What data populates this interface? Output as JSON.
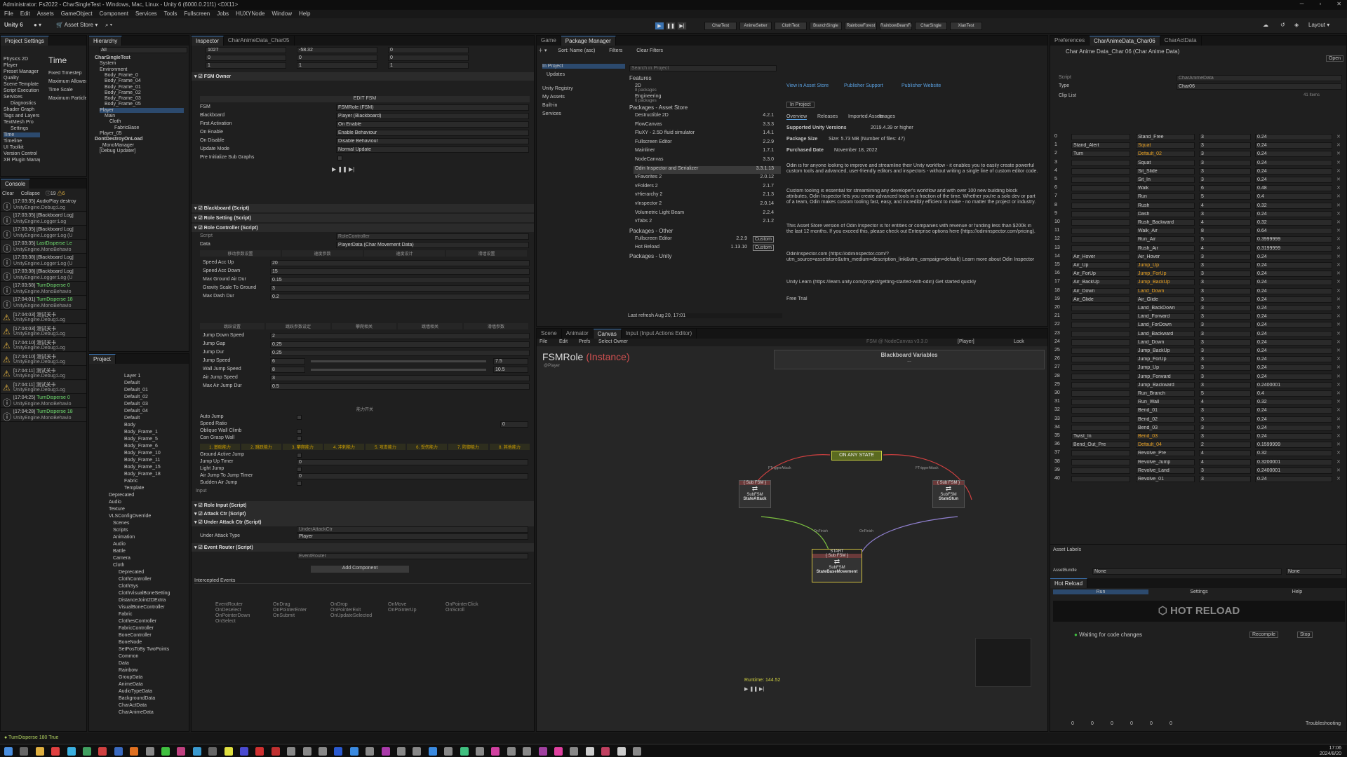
{
  "window": {
    "title": "Administrator: Fs2022 - CharSingleTest - Windows, Mac, Linux - Unity 6 (6000.0.21f1) <DX11>"
  },
  "menu": [
    "File",
    "Edit",
    "Assets",
    "GameObject",
    "Component",
    "Services",
    "Tools",
    "Fullscreen",
    "Jobs",
    "HUXYNode",
    "Window",
    "Help"
  ],
  "toolbar": {
    "account": "Unity 6",
    "asset_store": "Asset Store",
    "layouts": [
      "CharTest",
      "AnimeSetter",
      "ClothTest",
      "BranchSingle",
      "RainbowForest",
      "RainbowBeamFog",
      "CharSingle",
      "XianTest"
    ],
    "layout": "Layout"
  },
  "project_settings": {
    "tab": "Project Settings",
    "heading": "Time",
    "items": [
      "Physics 2D",
      "Player",
      "Preset Manager",
      "Quality",
      "Scene Template",
      "Script Execution",
      "Services",
      "Diagnostics",
      "Shader Graph",
      "Tags and Layers",
      "TextMesh Pro",
      "Settings",
      "Time",
      "Timeline",
      "UI Toolkit",
      "Version Control",
      "XR Plugin Management"
    ],
    "fields": [
      "Fixed Timestep",
      "Maximum Allowed",
      "Time Scale",
      "Maximum Particle"
    ]
  },
  "console": {
    "tab": "Console",
    "clear": "Clear",
    "collapse": "Collapse",
    "count_info": "19",
    "count_warn": "6",
    "entries": [
      {
        "type": "info",
        "time": "[17:03:35]",
        "msg": "AudioPlay destroy",
        "sub": "UnityEngine.Debug:Log"
      },
      {
        "type": "info",
        "time": "[17:03:35]",
        "msg": "[Blackboard Log]",
        "sub": "UnityEngine.Logger:Log"
      },
      {
        "type": "info",
        "time": "[17:03:35]",
        "msg": "[Blackboard Log]",
        "sub": "UnityEngine.Logger:Log (U"
      },
      {
        "type": "info",
        "time": "[17:03:35]",
        "msg": "LastDisperse Le",
        "sub": "UnityEngine.MonoBehavio"
      },
      {
        "type": "info",
        "time": "[17:03:38]",
        "msg": "[Blackboard Log]",
        "sub": "UnityEngine.Logger:Log (U"
      },
      {
        "type": "info",
        "time": "[17:03:38]",
        "msg": "[Blackboard Log]",
        "sub": "UnityEngine.Logger:Log (U"
      },
      {
        "type": "info",
        "time": "[17:03:58]",
        "msg": "TurnDisperse 0",
        "sub": "UnityEngine.MonoBehavio"
      },
      {
        "type": "info",
        "time": "[17:04:01]",
        "msg": "TurnDisperse 18",
        "sub": "UnityEngine.MonoBehavio"
      },
      {
        "type": "warn",
        "time": "[17:04:03]",
        "msg": "测试关卡",
        "sub": "UnityEngine.Debug:Log"
      },
      {
        "type": "warn",
        "time": "[17:04:03]",
        "msg": "测试关卡",
        "sub": "UnityEngine.Debug:Log"
      },
      {
        "type": "warn",
        "time": "[17:04:10]",
        "msg": "测试关卡",
        "sub": "UnityEngine.Debug:Log"
      },
      {
        "type": "warn",
        "time": "[17:04:10]",
        "msg": "测试关卡",
        "sub": "UnityEngine.Debug:Log"
      },
      {
        "type": "warn",
        "time": "[17:04:11]",
        "msg": "测试关卡",
        "sub": "UnityEngine.Debug:Log"
      },
      {
        "type": "warn",
        "time": "[17:04:11]",
        "msg": "测试关卡",
        "sub": "UnityEngine.Debug:Log"
      },
      {
        "type": "info",
        "time": "[17:04:25]",
        "msg": "TurnDisperse 0",
        "sub": "UnityEngine.MonoBehavio"
      },
      {
        "type": "info",
        "time": "[17:04:28]",
        "msg": "TurnDisperse 18",
        "sub": "UnityEngine.MonoBehavio"
      }
    ]
  },
  "hierarchy": {
    "tab": "Hierarchy",
    "search": "All",
    "items": [
      "CharSingleTest",
      "System",
      "Environment",
      "Body_Frame_0",
      "Body_Frame_04",
      "Body_Frame_01",
      "Body_Frame_02",
      "Body_Frame_03",
      "Body_Frame_05",
      "Player",
      "Main",
      "Cloth",
      "FabricBase",
      "Player_05",
      "DontDestroyOnLoad",
      "_MonoManager",
      "[Debug Updater]"
    ]
  },
  "project": {
    "tab": "Project",
    "items": [
      "Layer 1",
      "Default",
      "Default_01",
      "Default_02",
      "Default_03",
      "Default_04",
      "Default",
      "Body",
      "Body_Frame_1",
      "Body_Frame_5",
      "Body_Frame_6",
      "Body_Frame_10",
      "Body_Frame_11",
      "Body_Frame_15",
      "Body_Frame_18",
      "Fabric",
      "Template",
      "Deprecated",
      "Audio",
      "Texture",
      "VLSConfigOverride",
      "Scenes",
      "Scripts",
      "Animation",
      "Audio",
      "Battle",
      "Camera",
      "Cloth",
      "Deprecated",
      "ClothController",
      "ClothSys",
      "ClothVisualBoneSetting",
      "DistanceJoint2DExtra",
      "VisualBoneController",
      "Fabric",
      "ClothesController",
      "FabricController",
      "BoneController",
      "BoneNode",
      "SetPosToBy TwoPoints",
      "Common",
      "Data",
      "Rainbow",
      "GroupData",
      "AnimeData",
      "AudioTypeData",
      "BackgroundData",
      "CharActData",
      "CharAnimeData"
    ]
  },
  "inspector": {
    "tab": "Inspector",
    "tab2": "CharAnimeData_Char05",
    "transform": [
      {
        "x": "1027",
        "y": "-58.32",
        "z": "0"
      },
      {
        "x": "0",
        "y": "0",
        "z": "0"
      },
      {
        "x": "1",
        "y": "1",
        "z": "1"
      }
    ],
    "fsm_owner": {
      "title": "FSM Owner",
      "edit": "EDIT FSM",
      "fields": [
        [
          "FSM",
          "FSMRole (FSM)"
        ],
        [
          "Blackboard",
          "Player (Blackboard)"
        ],
        [
          "First Activation",
          "On Enable"
        ],
        [
          "On Enable",
          "Enable Behaviour"
        ],
        [
          "On Disable",
          "Disable Behaviour"
        ],
        [
          "Update Mode",
          "Normal Update"
        ],
        [
          "Pre Initialize Sub Graphs",
          ""
        ]
      ]
    },
    "components": [
      "Blackboard (Script)",
      "Role Setting (Script)",
      "Role Controller (Script)"
    ],
    "script_label": "Script",
    "script_value": "RoleController",
    "data_label": "Data",
    "data_value": "PlayerData (Char Movement Data)",
    "subtabs1": [
      "移动参数设置",
      "速度参数",
      "速度设计",
      "滑墙设置"
    ],
    "move_fields": [
      [
        "Speed Acc Up",
        "20"
      ],
      [
        "Speed Acc Down",
        "15"
      ],
      [
        "Max Ground Air Dur",
        "0.15"
      ],
      [
        "Gravity Scale To Ground",
        "3"
      ],
      [
        "Max Dash Dur",
        "0.2"
      ]
    ],
    "subtabs2": [
      "跳跃设置",
      "跳跃参数设定",
      "攀爬相关",
      "跳墙相关",
      "滑墙参数"
    ],
    "jump_fields": [
      [
        "Jump Down Speed",
        "2"
      ],
      [
        "Jump Gap",
        "0.25"
      ],
      [
        "Jump Dur",
        "0.25"
      ],
      [
        "Jump Speed",
        "6",
        "7.5"
      ],
      [
        "Wall Jump Speed",
        "8",
        "10.5"
      ],
      [
        "Air Jump Speed",
        "3"
      ],
      [
        "Max Air Jump Dur",
        "0.5"
      ]
    ],
    "ability_title": "能力开关",
    "ability_fields": [
      [
        "Auto Jump",
        ""
      ],
      [
        "Speed Ratio",
        "0"
      ],
      [
        "Oblique Wall Climb",
        ""
      ],
      [
        "Can Grasp Wall",
        ""
      ]
    ],
    "colortabs": [
      "1. 基础能力",
      "2. 跳跃能力",
      "3. 攀爬能力",
      "4. 冲刺能力",
      "5. 攻击能力",
      "6. 受伤能力",
      "7. 防御能力",
      "8. 其他能力"
    ],
    "state_fields": [
      [
        "Ground Active Jump",
        ""
      ],
      [
        "Jump Up Timer",
        "0"
      ],
      [
        "Light Jump",
        ""
      ],
      [
        "Air Jump To Jump Timer",
        "0"
      ],
      [
        "Sudden Air Jump",
        ""
      ]
    ],
    "input_label": "Input",
    "components2": [
      "Role Input (Script)",
      "Attack Ctr (Script)",
      "Under Attack Ctr (Script)"
    ],
    "under_script": "UnderAttackCtr",
    "under_type_label": "Under Attack Type",
    "under_type": "Player",
    "event_router": "Event Router (Script)",
    "event_script": "EventRouter",
    "add_component": "Add Component",
    "intercepted": "Intercepted Events",
    "events": [
      [
        "EventRouter",
        "OnDeselect",
        "OnPointerDown",
        "OnSelect"
      ],
      [
        "OnDrag",
        "OnPointerEnter",
        "OnSubmit"
      ],
      [
        "OnDrop",
        "OnPointerExit",
        "OnUpdateSelected"
      ],
      [
        "OnMove",
        "OnPointerUp"
      ],
      [
        "OnPointerClick",
        "OnScroll"
      ]
    ]
  },
  "package_manager": {
    "tabs": [
      "Game",
      "Package Manager"
    ],
    "sort": "Sort: Name (asc)",
    "filters": "Filters",
    "clear_filters": "Clear Filters",
    "search": "Search in Project",
    "left": [
      "In Project",
      "Updates",
      "Unity Registry",
      "My Assets",
      "Built-in",
      "Services"
    ],
    "features_title": "Features",
    "features": [
      [
        "2D",
        "8 packages"
      ],
      [
        "Engineering",
        "6 packages"
      ]
    ],
    "asset_title": "Packages - Asset Store",
    "assets": [
      [
        "Destructible 2D",
        "4.2.1"
      ],
      [
        "FlowCanvas",
        "3.3.3"
      ],
      [
        "FluXY - 2.5D fluid simulator",
        "1.4.1"
      ],
      [
        "Fullscreen Editor",
        "2.2.9"
      ],
      [
        "Mainliner",
        "1.7.1"
      ],
      [
        "NodeCanvas",
        "3.3.0"
      ],
      [
        "Odin Inspector and Serializer",
        "3.3.1.13"
      ],
      [
        "vFavorites 2",
        "2.0.12"
      ],
      [
        "vFolders 2",
        "2.1.7"
      ],
      [
        "vHierarchy 2",
        "2.1.3"
      ],
      [
        "vInspector 2",
        "2.0.14"
      ],
      [
        "Volumetric Light Beam",
        "2.2.4"
      ],
      [
        "vTabs 2",
        "2.1.2"
      ]
    ],
    "other_title": "Packages - Other",
    "others": [
      [
        "Fullscreen Editor",
        "2.2.9",
        "Custom"
      ],
      [
        "Hot Reload",
        "1.13.10",
        "Custom"
      ]
    ],
    "unity_title": "Packages - Unity",
    "refresh": "Last refresh Aug 20, 17:01",
    "detail": {
      "links": [
        "View in Asset Store",
        "Publisher Support",
        "Publisher Website"
      ],
      "in_project": "In Project",
      "subtabs": [
        "Overview",
        "Releases",
        "Imported Assets",
        "Images"
      ],
      "versions_label": "Supported Unity Versions",
      "versions": "2019.4.39 or higher",
      "size_label": "Package Size",
      "size": "Size: 5.73 MB (Number of files: 47)",
      "purchased_label": "Purchased Date",
      "purchased": "November 18, 2022",
      "desc1": "Odin is for anyone looking to improve and streamline their Unity workflow - it enables you to easily create powerful custom tools and advanced, user-friendly editors and inspectors - without writing a single line of custom editor code.",
      "desc2": "Custom tooling is essential for streamlining any developer's workflow and with over 100 new building block attributes, Odin Inspector lets you create advanced tools in a fraction of the time. Whether you're a solo dev or part of a team, Odin makes custom tooling fast, easy, and incredibly efficient to make - no matter the project or industry.",
      "desc3": "This Asset Store version of Odin Inspector is for entities or companies with revenue or funding less than $200k in the last 12 months. If you exceed this, please check out Enterprise options here (https://odininspector.com/pricing).",
      "desc4": "OdinInspector.com (https://odininspector.com/?utm_source=assetstore&utm_medium=description_link&utm_campaign=default) Learn more about Odin Inspector",
      "desc5": "Unity Learn (https://learn.unity.com/project/getting-started-with-odin) Get started quickly",
      "free": "Free Trial"
    }
  },
  "graph": {
    "tabs": [
      "Scene",
      "Animator",
      "Canvas",
      "Input (Input Actions Editor)"
    ],
    "menu": [
      "File",
      "Edit",
      "Prefs",
      "Select Owner"
    ],
    "owner": "[Player]",
    "lock": "Lock",
    "fsm_label": "FSM @ NodeCanvas v3.3.0",
    "title": "FSMRole",
    "instance": "(Instance)",
    "sub": "@Player",
    "blackboard": "Blackboard Variables",
    "bb_dots": "...",
    "any_state": "ON ANY STATE",
    "start": "START",
    "nodes": [
      {
        "tag": "{ Sub FSM }",
        "name": "SubFSM",
        "state": "StateAttack"
      },
      {
        "tag": "{ Sub FSM }",
        "name": "SubFSM",
        "state": "StateStun"
      },
      {
        "tag": "{ Sub FSM }",
        "name": "SubFSM",
        "state": "StateBaseMovement"
      }
    ],
    "edges": [
      "FTriggerAttack",
      "FTriggerAttack",
      "OnFinish",
      "OnFinish"
    ],
    "runtime": "Runtime: 144.52"
  },
  "right": {
    "tabs": [
      "Preferences",
      "CharAnimeData_Char06",
      "CharActData"
    ],
    "obj": "Char Anime Data_Char 06 (Char Anime Data)",
    "open": "Open",
    "script_label": "Script",
    "script": "CharAnimeData",
    "type_label": "Type",
    "type": "Char06",
    "clip_list": "Clip List",
    "items_label": "41 Items",
    "cols": [
      "Name",
      "Clip",
      "Total Frames",
      "Duration"
    ],
    "rows": [
      [
        "0",
        "",
        "Stand_Free",
        "3",
        "0.24"
      ],
      [
        "1",
        "Stand_Alert",
        "Squat",
        "3",
        "0.24"
      ],
      [
        "2",
        "Turn",
        "Default_02",
        "3",
        "0.24"
      ],
      [
        "3",
        "",
        "Squat",
        "3",
        "0.24"
      ],
      [
        "4",
        "",
        "Sit_Slide",
        "3",
        "0.24"
      ],
      [
        "5",
        "",
        "Sit_In",
        "3",
        "0.24"
      ],
      [
        "6",
        "",
        "Walk",
        "6",
        "0.48"
      ],
      [
        "7",
        "",
        "Run",
        "5",
        "0.4"
      ],
      [
        "8",
        "",
        "Rush",
        "4",
        "0.32"
      ],
      [
        "9",
        "",
        "Dash",
        "3",
        "0.24"
      ],
      [
        "10",
        "",
        "Rush_Backward",
        "4",
        "0.32"
      ],
      [
        "11",
        "",
        "Walk_Air",
        "8",
        "0.64"
      ],
      [
        "12",
        "",
        "Run_Air",
        "5",
        "0.3999999"
      ],
      [
        "13",
        "",
        "Rush_Air",
        "4",
        "0.3199999"
      ],
      [
        "14",
        "Air_Hover",
        "Air_Hover",
        "3",
        "0.24"
      ],
      [
        "15",
        "Air_Up",
        "Jump_Up",
        "3",
        "0.24"
      ],
      [
        "16",
        "Air_ForUp",
        "Jump_ForUp",
        "3",
        "0.24"
      ],
      [
        "17",
        "Air_BackUp",
        "Jump_BackUp",
        "3",
        "0.24"
      ],
      [
        "18",
        "Air_Down",
        "Land_Down",
        "3",
        "0.24"
      ],
      [
        "19",
        "Air_Glide",
        "Air_Glide",
        "3",
        "0.24"
      ],
      [
        "20",
        "",
        "Land_BackDown",
        "3",
        "0.24"
      ],
      [
        "21",
        "",
        "Land_Forward",
        "3",
        "0.24"
      ],
      [
        "22",
        "",
        "Land_ForDown",
        "3",
        "0.24"
      ],
      [
        "23",
        "",
        "Land_Backward",
        "3",
        "0.24"
      ],
      [
        "24",
        "",
        "Land_Down",
        "3",
        "0.24"
      ],
      [
        "25",
        "",
        "Jump_BackUp",
        "3",
        "0.24"
      ],
      [
        "26",
        "",
        "Jump_ForUp",
        "3",
        "0.24"
      ],
      [
        "27",
        "",
        "Jump_Up",
        "3",
        "0.24"
      ],
      [
        "28",
        "",
        "Jump_Forward",
        "3",
        "0.24"
      ],
      [
        "29",
        "",
        "Jump_Backward",
        "3",
        "0.2400001"
      ],
      [
        "30",
        "",
        "Run_Branch",
        "5",
        "0.4"
      ],
      [
        "31",
        "",
        "Run_Wall",
        "4",
        "0.32"
      ],
      [
        "32",
        "",
        "Bend_01",
        "3",
        "0.24"
      ],
      [
        "33",
        "",
        "Bend_02",
        "3",
        "0.24"
      ],
      [
        "34",
        "",
        "Bend_03",
        "3",
        "0.24"
      ],
      [
        "35",
        "Twist_In",
        "Bend_03",
        "3",
        "0.24"
      ],
      [
        "36",
        "Bend_Out_Pre",
        "Default_04",
        "2",
        "0.1599999"
      ],
      [
        "37",
        "",
        "Revolve_Pre",
        "4",
        "0.32"
      ],
      [
        "38",
        "",
        "Revolve_Jump",
        "4",
        "0.3200001"
      ],
      [
        "39",
        "",
        "Revolve_Land",
        "3",
        "0.2400001"
      ],
      [
        "40",
        "",
        "Revolve_01",
        "3",
        "0.24"
      ]
    ],
    "highlight_rows": [
      1,
      2,
      15,
      16,
      17,
      18,
      35,
      36
    ],
    "asset_labels": "Asset Labels",
    "assetbundle_label": "AssetBundle",
    "assetbundle": "None",
    "variant": "None",
    "hot_reload": {
      "tab": "Hot Reload",
      "run": "Run",
      "settings": "Settings",
      "help": "Help",
      "logo": "HOT RELOAD",
      "status": "Waiting for code changes",
      "recompile": "Recompile",
      "stop": "Stop"
    },
    "status_counts": [
      "0",
      "0",
      "0",
      "0",
      "0",
      "0"
    ],
    "troubleshoot": "Troubleshooting"
  },
  "statusbar": {
    "text": "TurnDisperse 180 True"
  },
  "taskbar": {
    "time": "17:06",
    "date": "2024/8/20"
  }
}
